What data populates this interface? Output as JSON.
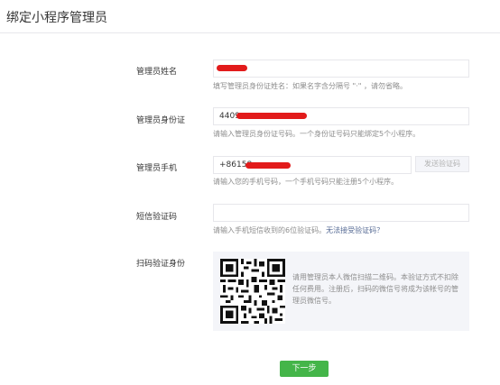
{
  "page": {
    "title": "绑定小程序管理员"
  },
  "fields": {
    "name": {
      "label": "管理员姓名",
      "value": "",
      "hint": "填写管理员身份证姓名：如果名字含分隔号 \"·\" ，请勿省略。"
    },
    "id_number": {
      "label": "管理员身份证",
      "value": "4409",
      "hint": "请输入管理员身份证号码。一个身份证号码只能绑定5个小程序。"
    },
    "phone": {
      "label": "管理员手机",
      "value": "+86158",
      "hint": "请输入您的手机号码，一个手机号码只能注册5个小程序。",
      "send_code_label": "发送验证码"
    },
    "sms_code": {
      "label": "短信验证码",
      "value": "",
      "hint": "请输入手机短信收到的6位验证码。",
      "link": "无法接受验证码？"
    },
    "qr_verify": {
      "label": "扫码验证身份",
      "text": "请用管理员本人微信扫描二维码。本验证方式不扣除任何费用。注册后，扫码的微信号将成为该帐号的管理员微信号。"
    }
  },
  "actions": {
    "next_label": "下一步"
  },
  "colors": {
    "primary": "#44b549",
    "link": "#576b95",
    "redaction": "#e21b1b"
  }
}
